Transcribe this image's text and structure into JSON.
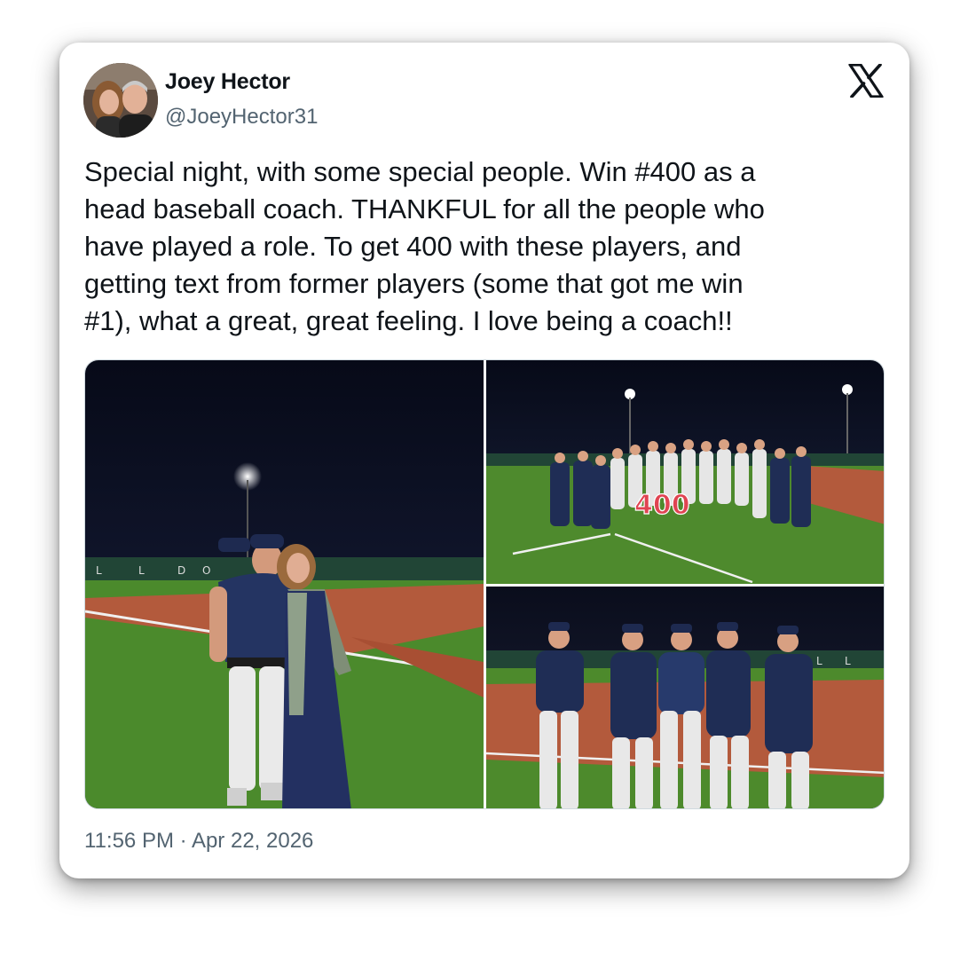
{
  "tweet": {
    "author": {
      "display_name": "Joey Hector",
      "handle": "@JoeyHector31",
      "avatar_alt": "avatar"
    },
    "text": "Special night, with some special people.  Win #400 as a\nhead baseball coach.  THANKFUL for all the people who\nhave played a role.  To get 400 with these players, and\ngetting text from former players (some that got me win\n#1), what a great, great feeling.  I love being a coach!!",
    "timestamp": "11:56 PM · Apr 22, 2026",
    "photos": [
      {
        "name": "coach-with-woman-photo"
      },
      {
        "name": "team-400-photo",
        "sign_text": "400"
      },
      {
        "name": "coaching-staff-photo"
      }
    ]
  },
  "platform": {
    "logo_icon": "x-logo-icon"
  },
  "colors": {
    "text_primary": "#0f1419",
    "text_secondary": "#536471",
    "night_sky": "#0b1020",
    "turf": "#4f8a2e",
    "infield_clay": "#b5563a",
    "uniform_navy": "#1f2d55"
  }
}
